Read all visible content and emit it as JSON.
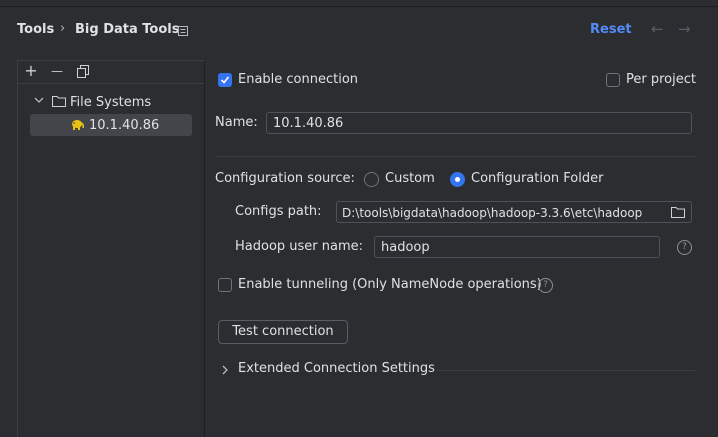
{
  "header": {
    "breadcrumb_root": "Tools",
    "breadcrumb_separator": "›",
    "breadcrumb_current": "Big Data Tools",
    "reset_label": "Reset",
    "back_arrow": "←",
    "forward_arrow": "→"
  },
  "sidebar": {
    "toolbar": {
      "add": "+",
      "remove": "—",
      "copy": "copy-icon"
    },
    "tree": {
      "group_label": "File Systems",
      "item_label": "10.1.40.86"
    }
  },
  "form": {
    "enable_connection_label": "Enable connection",
    "enable_connection_checked": true,
    "per_project_label": "Per project",
    "per_project_checked": false,
    "name_label": "Name:",
    "name_value": "10.1.40.86",
    "config_source_label": "Configuration source:",
    "config_source_options": [
      "Custom",
      "Configuration Folder"
    ],
    "config_source_selected": "Configuration Folder",
    "configs_path_label": "Configs path:",
    "configs_path_value": "D:\\tools\\bigdata\\hadoop\\hadoop-3.3.6\\etc\\hadoop",
    "hadoop_user_label": "Hadoop user name:",
    "hadoop_user_value": "hadoop",
    "tunneling_label": "Enable tunneling (Only NameNode operations)",
    "tunneling_checked": false,
    "help_glyph": "?",
    "test_connection_label": "Test connection",
    "extended_settings_label": "Extended Connection Settings"
  },
  "colors": {
    "accent": "#3574f0",
    "link": "#548af7",
    "background": "#2b2d30"
  }
}
